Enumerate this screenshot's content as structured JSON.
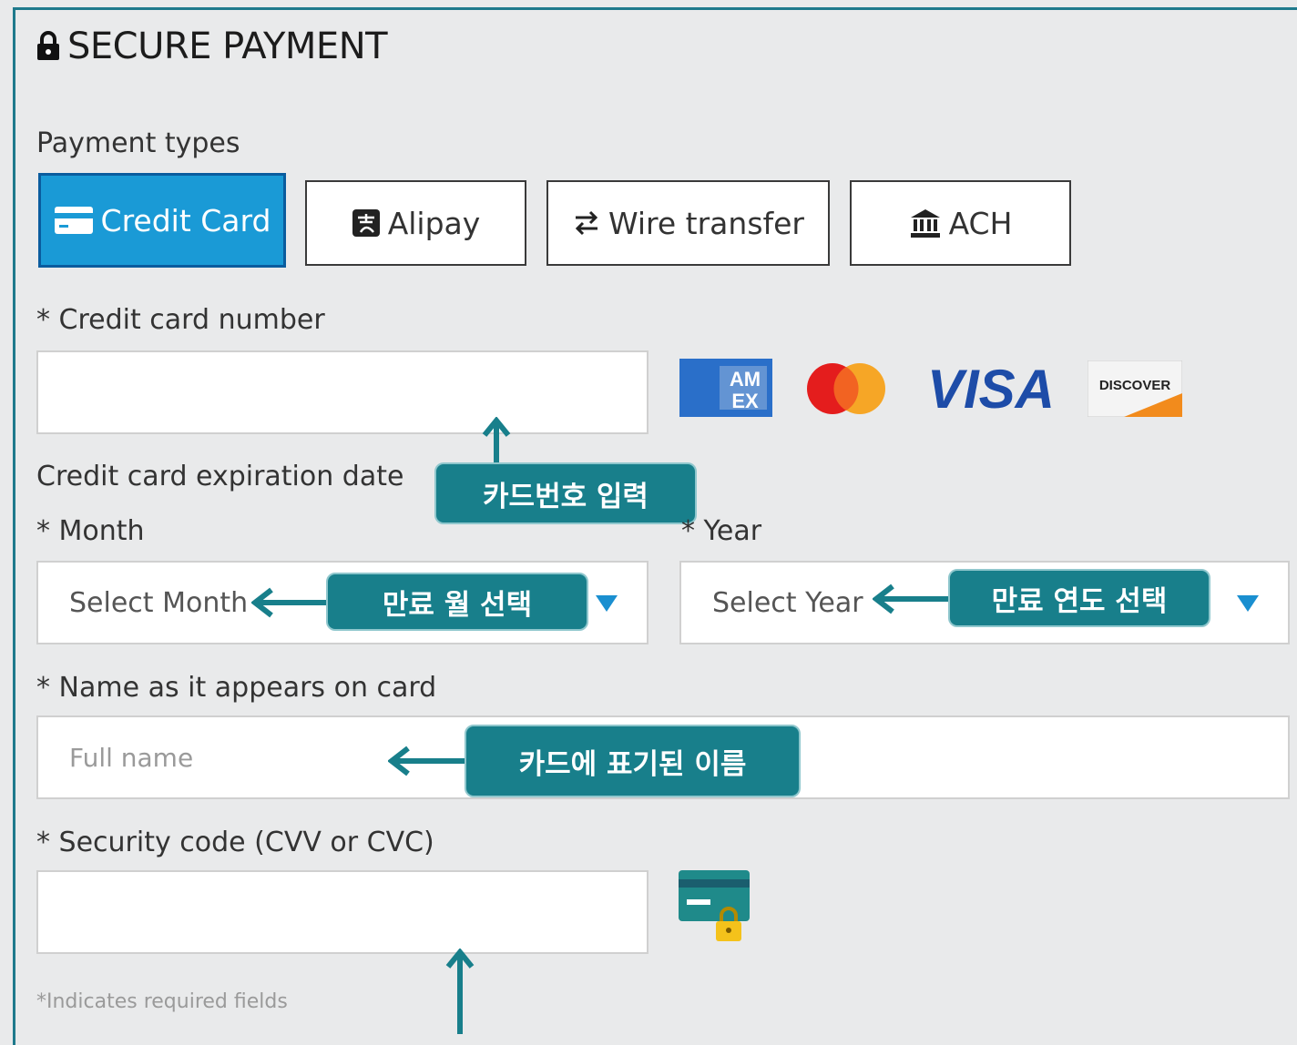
{
  "title": "SECURE PAYMENT",
  "payment_types_label": "Payment types",
  "tabs": [
    {
      "label": "Credit Card",
      "icon": "credit-card-icon",
      "active": true
    },
    {
      "label": "Alipay",
      "icon": "alipay-icon",
      "active": false
    },
    {
      "label": "Wire transfer",
      "icon": "transfer-arrows-icon",
      "active": false
    },
    {
      "label": "ACH",
      "icon": "bank-icon",
      "active": false
    }
  ],
  "card_number_label": "Credit card number",
  "card_number_value": "",
  "card_logos": {
    "amex": "AM EX",
    "mastercard": "mastercard",
    "visa": "VISA",
    "discover": "DISCOVER"
  },
  "expiration_label": "Credit card expiration date",
  "month_label": "Month",
  "month_select": "Select Month",
  "year_label": "Year",
  "year_select": "Select Year",
  "name_label": "Name as it appears on card",
  "name_placeholder": "Full name",
  "cvv_label": "Security code (CVV or CVC)",
  "cvv_value": "",
  "footnote": "*Indicates required fields",
  "callouts": {
    "card_number": "카드번호 입력",
    "month": "만료 월 선택",
    "year": "만료 연도 선택",
    "name": "카드에 표기된 이름"
  },
  "colors": {
    "accent": "#1a9ad6",
    "callout": "#187f8b",
    "frame": "#1f7a8c"
  }
}
